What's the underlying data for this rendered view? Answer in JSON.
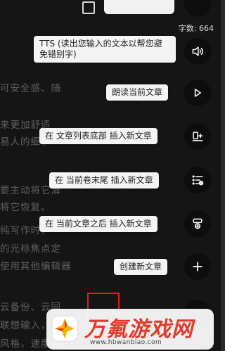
{
  "status": {
    "word_count": "字数: 664"
  },
  "background_text": [
    "可安全感、随",
    "来更加舒适",
    "易人的细节",
    "要主动将它清",
    "将它恢复。",
    "纯写作时，",
    "的光标焦点定",
    "使用其他编辑器",
    "云备份、云同",
    "联想输入，",
    "风格，速度遭"
  ],
  "actions": [
    {
      "label": "TTS (读出您输入的文本以帮您避免错别字)",
      "icon": "speaker-icon"
    },
    {
      "label": "朗读当前文章",
      "icon": "play-icon"
    },
    {
      "label": "在 文章列表底部 插入新文章",
      "icon": "insert-bottom-icon"
    },
    {
      "label": "在 当前卷末尾 插入新文章",
      "icon": "list-add-icon"
    },
    {
      "label": "在 当前文章之后 插入新文章",
      "icon": "insert-after-icon"
    },
    {
      "label": "创建新文章",
      "icon": "plus-icon"
    }
  ],
  "watermark": {
    "title": "万氟游戏网",
    "url": "www.hbwanbiao.com"
  },
  "colors": {
    "tooltip_bg": "#f4f4f4",
    "fab_bg": "#0d0d0d",
    "highlight_box": "#d72020",
    "watermark_red": "#e23b2e"
  }
}
